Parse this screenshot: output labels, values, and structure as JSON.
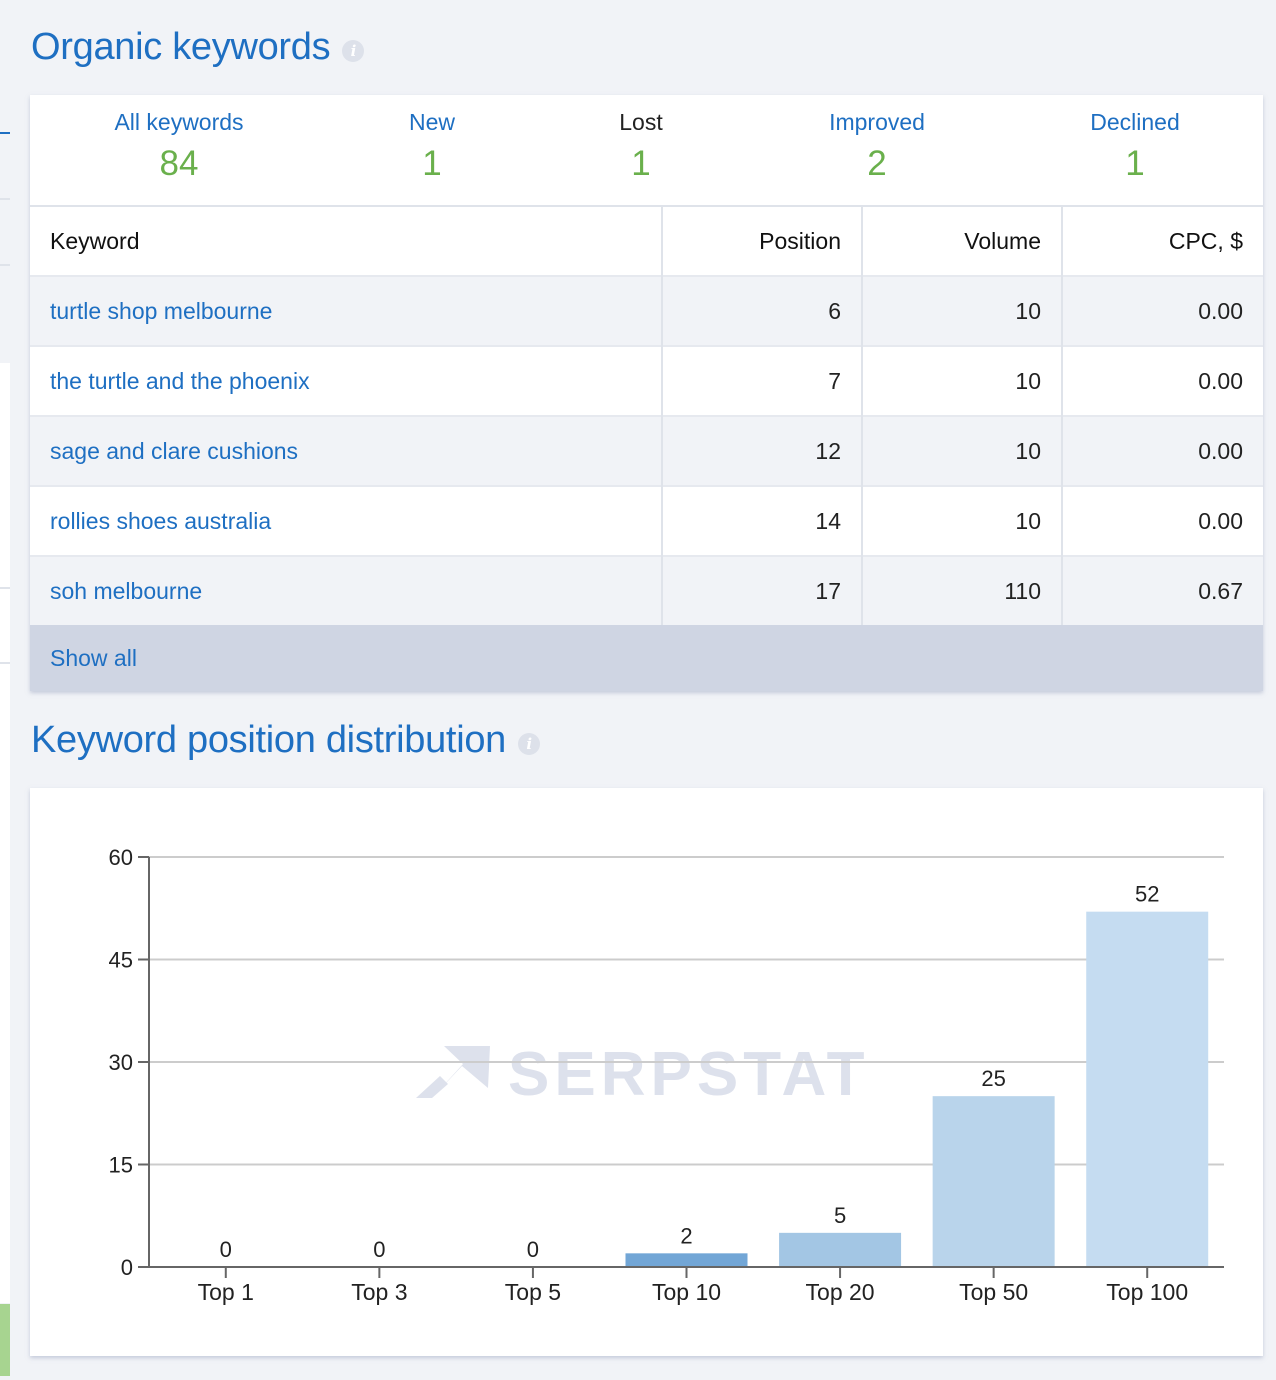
{
  "organic_keywords": {
    "title": "Organic keywords",
    "info_icon": "info-icon",
    "summary": [
      {
        "label": "All keywords",
        "value": "84",
        "active": true
      },
      {
        "label": "New",
        "value": "1",
        "active": true
      },
      {
        "label": "Lost",
        "value": "1",
        "active": false
      },
      {
        "label": "Improved",
        "value": "2",
        "active": true
      },
      {
        "label": "Declined",
        "value": "1",
        "active": true
      }
    ],
    "table": {
      "columns": [
        "Keyword",
        "Position",
        "Volume",
        "CPC, $"
      ],
      "rows": [
        {
          "keyword": "turtle shop melbourne",
          "position": "6",
          "volume": "10",
          "cpc": "0.00"
        },
        {
          "keyword": "the turtle and the phoenix",
          "position": "7",
          "volume": "10",
          "cpc": "0.00"
        },
        {
          "keyword": "sage and clare cushions",
          "position": "12",
          "volume": "10",
          "cpc": "0.00"
        },
        {
          "keyword": "rollies shoes australia",
          "position": "14",
          "volume": "10",
          "cpc": "0.00"
        },
        {
          "keyword": "soh melbourne",
          "position": "17",
          "volume": "110",
          "cpc": "0.67"
        }
      ]
    },
    "show_all_label": "Show all"
  },
  "position_distribution": {
    "title": "Keyword position distribution",
    "info_icon": "info-icon",
    "watermark": "SERPSTAT"
  },
  "colors": {
    "accent": "#1e6fc2",
    "value_green": "#6ab04c",
    "bar_colors": [
      "#72a6d6",
      "#72a6d6",
      "#72a6d6",
      "#72a6d6",
      "#a3c6e4",
      "#b9d4eb",
      "#c5dcf1"
    ]
  },
  "chart_data": {
    "type": "bar",
    "title": "Keyword position distribution",
    "categories": [
      "Top 1",
      "Top 3",
      "Top 5",
      "Top 10",
      "Top 20",
      "Top 50",
      "Top 100"
    ],
    "values": [
      0,
      0,
      0,
      2,
      5,
      25,
      52
    ],
    "xlabel": "",
    "ylabel": "",
    "ylim": [
      0,
      60
    ],
    "yticks": [
      0,
      15,
      30,
      45,
      60
    ],
    "grid": true,
    "data_labels": true,
    "legend": "none"
  }
}
